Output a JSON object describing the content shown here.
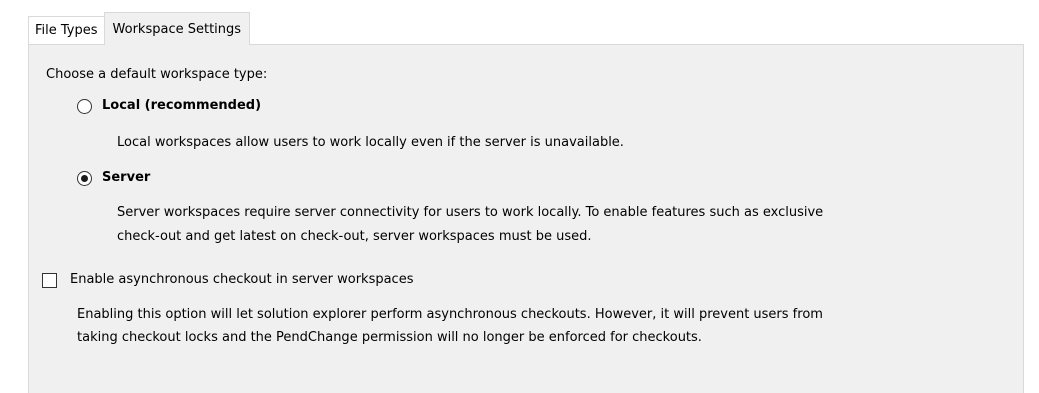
{
  "tabs": [
    {
      "label": "File Types",
      "active": false
    },
    {
      "label": "Workspace Settings",
      "active": true
    }
  ],
  "workspace": {
    "prompt": "Choose a default workspace type:",
    "options": [
      {
        "label": "Local (recommended)",
        "selected": false,
        "description": [
          "Local workspaces allow users to work locally even if the server is unavailable."
        ]
      },
      {
        "label": "Server",
        "selected": true,
        "description": [
          "Server workspaces require server connectivity for users to work locally. To enable features such as exclusive",
          "check-out and get latest on check-out, server workspaces must be used."
        ]
      }
    ]
  },
  "async_checkout": {
    "label": "Enable asynchronous checkout in server workspaces",
    "checked": false,
    "description": [
      "Enabling this option will let solution explorer perform asynchronous checkouts. However, it will prevent users from",
      "taking checkout locks and the PendChange permission will no longer be enforced for checkouts."
    ]
  },
  "colors": {
    "panel_background": "#f0f0f0",
    "border": "#d9d9d9",
    "text": "#000000"
  }
}
